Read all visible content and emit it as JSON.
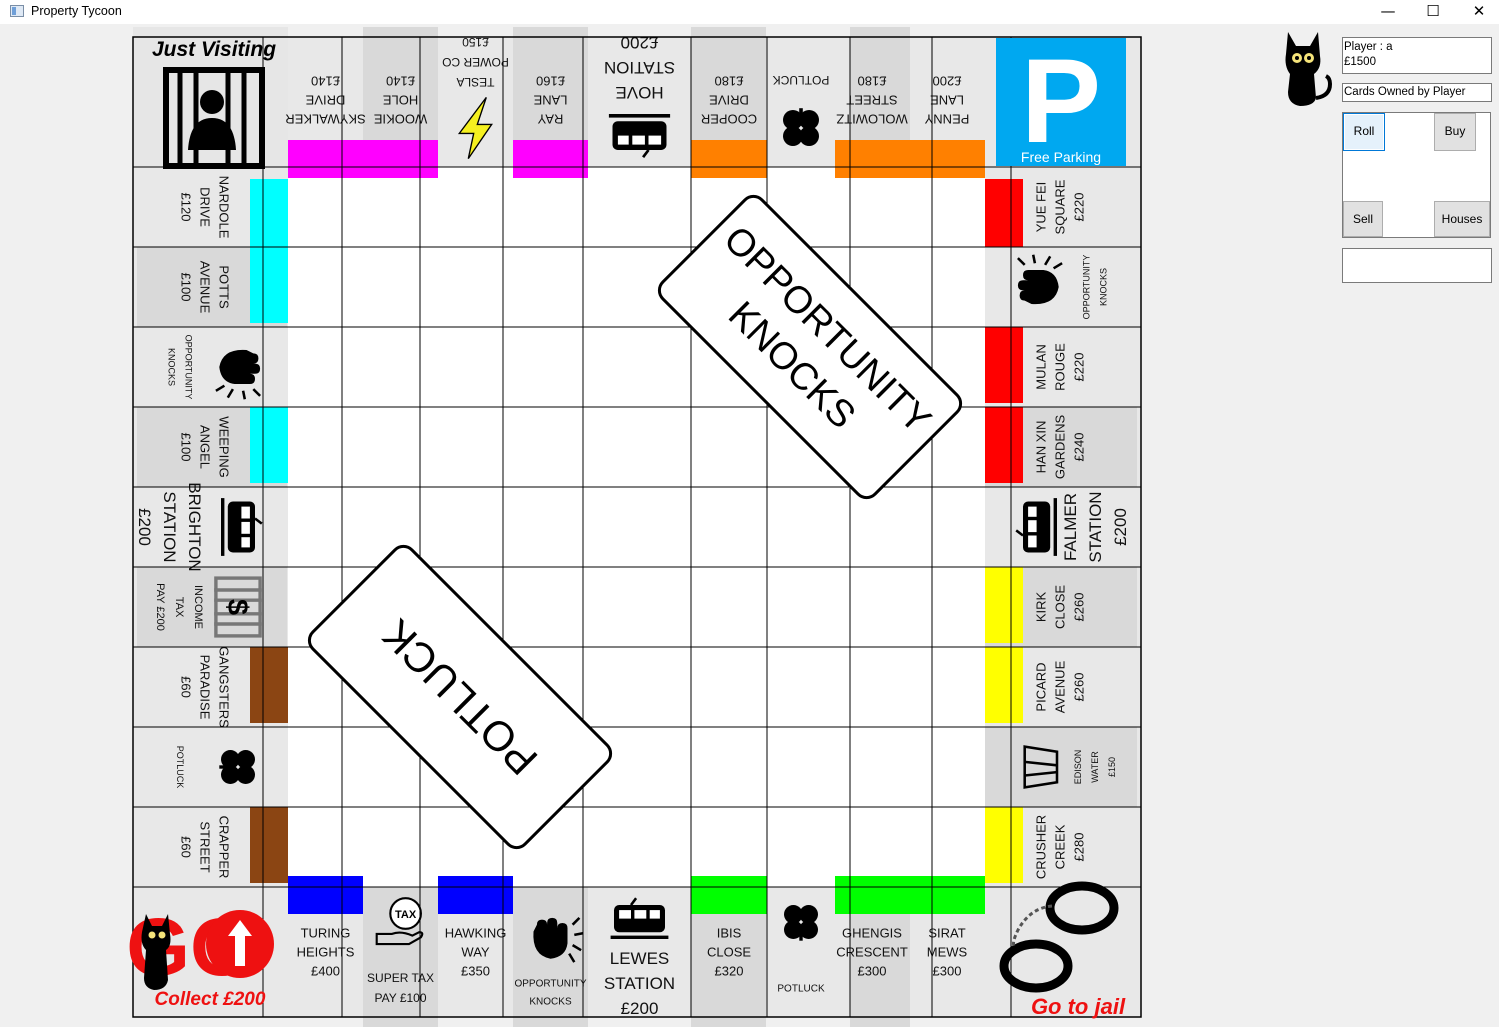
{
  "window": {
    "title": "Property Tycoon",
    "minimize": "—",
    "maximize": "☐",
    "close": "✕"
  },
  "panel": {
    "player_info": "Player : a\n£1500",
    "cards_label": "Cards Owned by Player",
    "buttons": {
      "roll": "Roll",
      "buy": "Buy",
      "sell": "Sell",
      "houses": "Houses"
    },
    "status": ""
  },
  "board": {
    "center": {
      "opportunity": [
        "OPPORTUNITY",
        "KNOCKS"
      ],
      "potluck": "POTLUCK"
    },
    "corners": {
      "go": {
        "text": "GO",
        "caption": "Collect £200"
      },
      "just_visiting": "Just Visiting",
      "free_parking": {
        "letter": "P",
        "caption": "Free Parking"
      },
      "go_to_jail": "Go to jail"
    },
    "bottom": [
      {
        "lines": [
          "TURING",
          "HEIGHTS",
          "£400"
        ],
        "color": "#0000ff"
      },
      {
        "lines": [
          "SUPER TAX",
          "PAY £100"
        ],
        "icon": "tax-hand-icon",
        "tax_label": "TAX"
      },
      {
        "lines": [
          "HAWKING",
          "WAY",
          "£350"
        ],
        "color": "#0000ff"
      },
      {
        "lines": [
          "OPPORTUNITY",
          "KNOCKS"
        ],
        "icon": "knocking-hand-icon"
      },
      {
        "lines": [
          "LEWES",
          "STATION",
          "£200"
        ],
        "icon": "train-icon"
      },
      {
        "lines": [
          "IBIS",
          "CLOSE",
          "£320"
        ],
        "color": "#00ff00"
      },
      {
        "lines": [
          "POTLUCK"
        ],
        "icon": "clover-icon"
      },
      {
        "lines": [
          "GHENGIS",
          "CRESCENT",
          "£300"
        ],
        "color": "#00ff00"
      },
      {
        "lines": [
          "SIRAT",
          "MEWS",
          "£300"
        ],
        "color": "#00ff00"
      }
    ],
    "left": [
      {
        "lines": [
          "CRAPPER",
          "STREET",
          "£60"
        ],
        "color": "#8b4513"
      },
      {
        "lines": [
          "POTLUCK"
        ],
        "icon": "clover-icon"
      },
      {
        "lines": [
          "GANGSTERS",
          "PARADISE",
          "£60"
        ],
        "color": "#8b4513"
      },
      {
        "lines": [
          "INCOME",
          "TAX",
          "PAY £200"
        ],
        "icon": "income-tax-icon"
      },
      {
        "lines": [
          "BRIGHTON",
          "STATION",
          "£200"
        ],
        "icon": "train-icon"
      },
      {
        "lines": [
          "WEEPING",
          "ANGEL",
          "£100"
        ],
        "color": "#00ffff"
      },
      {
        "lines": [
          "OPPORTUNITY",
          "KNOCKS"
        ],
        "icon": "knocking-hand-icon"
      },
      {
        "lines": [
          "POTTS",
          "AVENUE",
          "£100"
        ],
        "color": "#00ffff"
      },
      {
        "lines": [
          "NARDOLE",
          "DRIVE",
          "£120"
        ],
        "color": "#00ffff"
      }
    ],
    "top": [
      {
        "lines": [
          "SKYWALKER",
          "DRIVE",
          "£140"
        ],
        "color": "#ff00ff"
      },
      {
        "lines": [
          "WOOKIE",
          "HOLE",
          "£140"
        ],
        "color": "#ff00ff"
      },
      {
        "lines": [
          "TESLA",
          "POWER CO",
          "£150"
        ],
        "icon": "lightning-icon"
      },
      {
        "lines": [
          "RAY",
          "LANE",
          "£160"
        ],
        "color": "#ff00ff"
      },
      {
        "lines": [
          "HOVE",
          "STATION",
          "£200"
        ],
        "icon": "train-icon"
      },
      {
        "lines": [
          "COOPER",
          "DRIVE",
          "£180"
        ],
        "color": "#ff8000"
      },
      {
        "lines": [
          "POTLUCK"
        ],
        "icon": "clover-icon"
      },
      {
        "lines": [
          "WOLOWITZ",
          "STREET",
          "£180"
        ],
        "color": "#ff8000"
      },
      {
        "lines": [
          "PENNY",
          "LANE",
          "£200"
        ],
        "color": "#ff8000"
      }
    ],
    "right": [
      {
        "lines": [
          "YUE FEI",
          "SQUARE",
          "£220"
        ],
        "color": "#ff0000"
      },
      {
        "lines": [
          "OPPORTUNITY",
          "KNOCKS"
        ],
        "icon": "knocking-hand-icon"
      },
      {
        "lines": [
          "MULAN",
          "ROUGE",
          "£220"
        ],
        "color": "#ff0000"
      },
      {
        "lines": [
          "HAN XIN",
          "GARDENS",
          "£240"
        ],
        "color": "#ff0000"
      },
      {
        "lines": [
          "FALMER",
          "STATION",
          "£200"
        ],
        "icon": "train-icon"
      },
      {
        "lines": [
          "KIRK",
          "CLOSE",
          "£260"
        ],
        "color": "#ffff00"
      },
      {
        "lines": [
          "PICARD",
          "AVENUE",
          "£260"
        ],
        "color": "#ffff00"
      },
      {
        "lines": [
          "EDISON",
          "WATER",
          "£150"
        ],
        "icon": "water-glass-icon"
      },
      {
        "lines": [
          "CRUSHER",
          "CREEK",
          "£280"
        ],
        "color": "#ffff00"
      }
    ]
  }
}
